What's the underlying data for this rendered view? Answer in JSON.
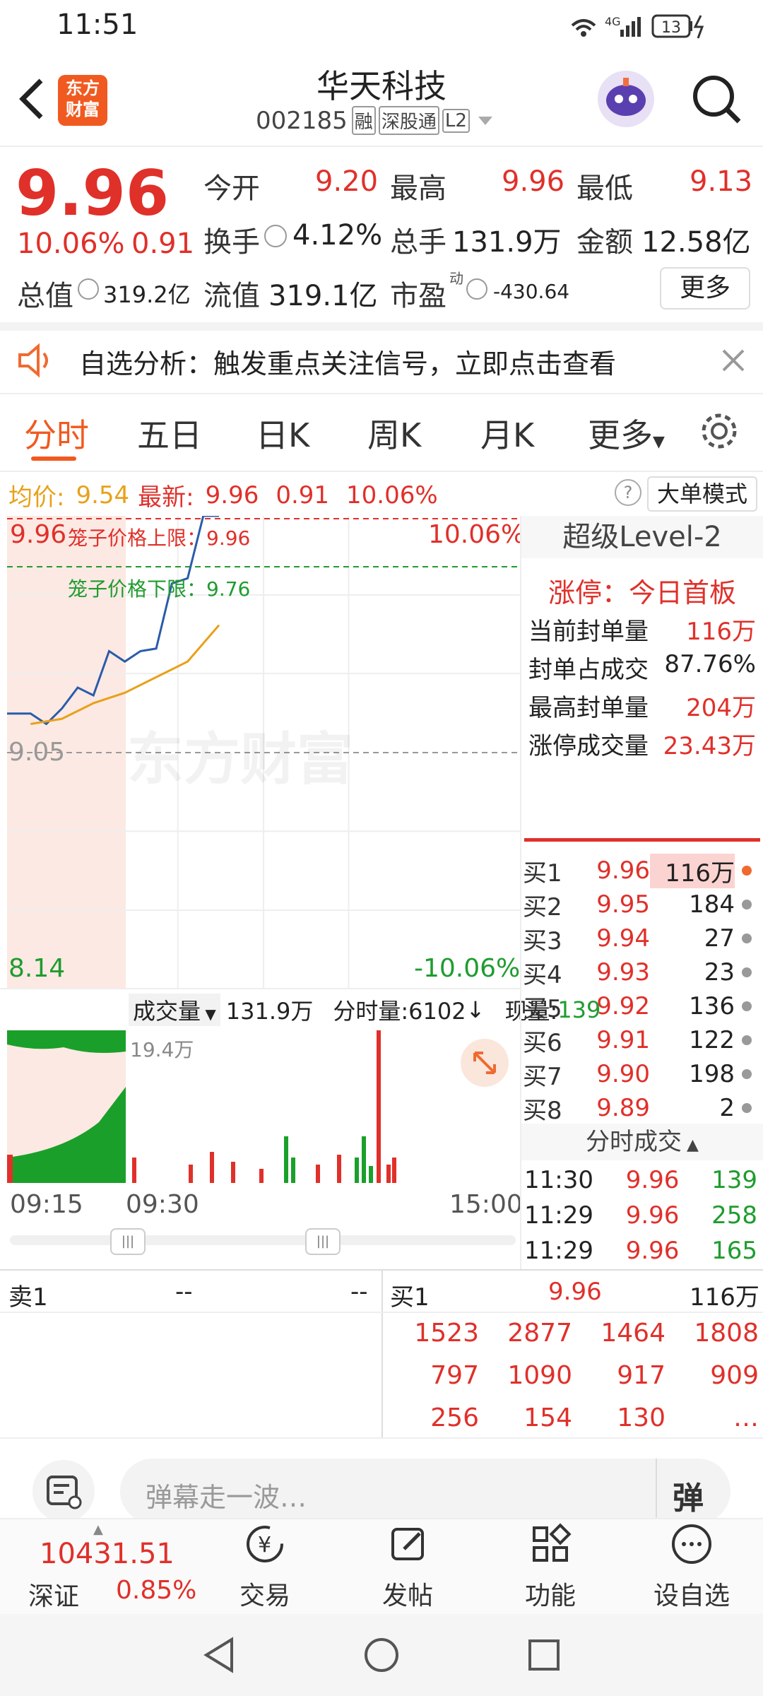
{
  "status_bar": {
    "time": "11:51",
    "network": "4G",
    "battery": "13"
  },
  "header": {
    "back_icon": "back-arrow-icon",
    "logo_text": "东方\n财富",
    "stock_name": "华天科技",
    "stock_code": "002185",
    "tags": [
      "融",
      "深股通",
      "L2"
    ]
  },
  "quote": {
    "price": "9.96",
    "change_pct": "10.06%",
    "change": "0.91",
    "open_label": "今开",
    "open": "9.20",
    "high_label": "最高",
    "high": "9.96",
    "low_label": "最低",
    "low": "9.13",
    "turnover_label": "换手",
    "turnover": "4.12%",
    "volume_label": "总手",
    "volume": "131.9万",
    "amount_label": "金额",
    "amount": "12.58亿",
    "mktcap_label": "总值",
    "mktcap": "319.2亿",
    "float_label": "流值",
    "float": "319.1亿",
    "pe_label": "市盈",
    "pe_sup": "动",
    "pe": "-430.64",
    "more": "更多"
  },
  "notice": {
    "text": "自选分析：触发重点关注信号，立即点击查看"
  },
  "tabs": [
    "分时",
    "五日",
    "日K",
    "周K",
    "月K",
    "更多"
  ],
  "info_bar": {
    "avg_label": "均价:",
    "avg": "9.54",
    "latest_label": "最新:",
    "latest": "9.96",
    "change": "0.91",
    "pct": "10.06%",
    "mode_button": "大单模式"
  },
  "chart": {
    "top_price": "9.96",
    "top_pct": "10.06%",
    "mid_price": "9.05",
    "bottom_price": "8.14",
    "bottom_pct": "-10.06%",
    "upper_limit_label": "笼子价格上限：9.96",
    "lower_limit_label": "笼子价格下限：9.76",
    "watermark": "东方财富",
    "vol_selector": "成交量",
    "vol_total": "131.9万",
    "vol_bar_label": "分时量:6102",
    "vol_now_label": "现量:",
    "vol_now": "139",
    "vol_peak": "19.4万",
    "time_labels": [
      "09:15",
      "09:30",
      "15:00"
    ]
  },
  "chart_data": {
    "type": "line",
    "series": [
      {
        "name": "最新",
        "x": [
          "09:15",
          "09:30",
          "09:40",
          "09:50",
          "10:00",
          "10:10",
          "10:20",
          "10:30",
          "10:40",
          "10:50",
          "11:00",
          "11:10",
          "11:20",
          "11:30"
        ],
        "values": [
          9.2,
          9.2,
          9.16,
          9.22,
          9.3,
          9.27,
          9.44,
          9.4,
          9.44,
          9.45,
          9.7,
          9.72,
          9.96,
          9.96
        ]
      },
      {
        "name": "均价",
        "x": [
          "09:30",
          "09:50",
          "10:10",
          "10:30",
          "10:50",
          "11:10",
          "11:30"
        ],
        "values": [
          9.16,
          9.18,
          9.24,
          9.28,
          9.34,
          9.4,
          9.54
        ]
      }
    ],
    "ylim": [
      8.14,
      9.96
    ]
  },
  "level2": {
    "title": "超级Level-2",
    "limit_status": "涨停：今日首板",
    "rows": [
      {
        "label": "当前封单量",
        "value": "116万"
      },
      {
        "label": "封单占成交",
        "value": "87.76%"
      },
      {
        "label": "最高封单量",
        "value": "204万"
      },
      {
        "label": "涨停成交量",
        "value": "23.43万"
      }
    ]
  },
  "orderbook": [
    {
      "label": "买1",
      "price": "9.96",
      "vol": "116万"
    },
    {
      "label": "买2",
      "price": "9.95",
      "vol": "184"
    },
    {
      "label": "买3",
      "price": "9.94",
      "vol": "27"
    },
    {
      "label": "买4",
      "price": "9.93",
      "vol": "23"
    },
    {
      "label": "买5",
      "price": "9.92",
      "vol": "136"
    },
    {
      "label": "买6",
      "price": "9.91",
      "vol": "122"
    },
    {
      "label": "买7",
      "price": "9.90",
      "vol": "198"
    },
    {
      "label": "买8",
      "price": "9.89",
      "vol": "2"
    }
  ],
  "ticks": {
    "title": "分时成交",
    "rows": [
      {
        "time": "11:30",
        "price": "9.96",
        "vol": "139"
      },
      {
        "time": "11:29",
        "price": "9.96",
        "vol": "258"
      },
      {
        "time": "11:29",
        "price": "9.96",
        "vol": "165"
      }
    ]
  },
  "queue": {
    "sell_label": "卖1",
    "sell_price": "--",
    "sell_vol": "--",
    "buy_label": "买1",
    "buy_price": "9.96",
    "buy_vol": "116万",
    "orders": [
      [
        "1523",
        "2877",
        "1464",
        "1808"
      ],
      [
        "797",
        "1090",
        "917",
        "909"
      ],
      [
        "256",
        "154",
        "130",
        "…"
      ]
    ]
  },
  "danmaku": {
    "placeholder": "弹幕走一波…",
    "button": "弹"
  },
  "bottom_nav": {
    "index_value": "10431.51",
    "index_name": "深证",
    "index_pct": "0.85%",
    "items": [
      "交易",
      "发帖",
      "功能",
      "设自选"
    ]
  }
}
